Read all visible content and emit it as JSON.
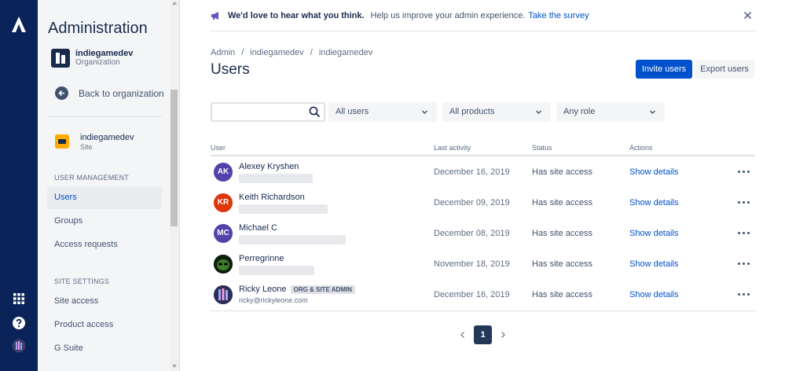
{
  "nav": {
    "title": "Administration",
    "org": {
      "name": "indiegamedev",
      "type": "Organization"
    },
    "back_label": "Back to organization",
    "site": {
      "name": "indiegamedev",
      "type": "Site"
    },
    "sections": [
      {
        "label": "USER MANAGEMENT",
        "items": [
          "Users",
          "Groups",
          "Access requests"
        ]
      },
      {
        "label": "SITE SETTINGS",
        "items": [
          "Site access",
          "Product access",
          "G Suite"
        ]
      }
    ],
    "active_item": "Users"
  },
  "banner": {
    "bold": "We'd love to hear what you think.",
    "text": "Help us improve your admin experience.",
    "link": "Take the survey"
  },
  "breadcrumb": [
    "Admin",
    "indiegamedev",
    "indiegamedev"
  ],
  "page_title": "Users",
  "actions": {
    "invite": "Invite users",
    "export": "Export users"
  },
  "filters": {
    "search_placeholder": "",
    "users": "All users",
    "products": "All products",
    "role": "Any role"
  },
  "table": {
    "headers": {
      "user": "User",
      "last_activity": "Last activity",
      "status": "Status",
      "actions": "Actions"
    },
    "rows": [
      {
        "initials": "AK",
        "avatar_color": "#5243aa",
        "name": "Alexey Kryshen",
        "email": "",
        "badge": "",
        "last_activity": "December 16, 2019",
        "status": "Has site access",
        "action": "Show details"
      },
      {
        "initials": "KR",
        "avatar_color": "#de350b",
        "name": "Keith Richardson",
        "email": "",
        "badge": "",
        "last_activity": "December 09, 2019",
        "status": "Has site access",
        "action": "Show details"
      },
      {
        "initials": "MC",
        "avatar_color": "#5243aa",
        "name": "Michael C",
        "email": "",
        "badge": "",
        "last_activity": "December 08, 2019",
        "status": "Has site access",
        "action": "Show details"
      },
      {
        "initials": "",
        "avatar_color": "#1b3a1b",
        "name": "Perregrinne",
        "email": "",
        "badge": "",
        "last_activity": "November 18, 2019",
        "status": "Has site access",
        "action": "Show details"
      },
      {
        "initials": "",
        "avatar_color": "#3b3f6b",
        "name": "Ricky Leone",
        "email": "ricky@rickyleone.com",
        "badge": "ORG & SITE ADMIN",
        "last_activity": "December 16, 2019",
        "status": "Has site access",
        "action": "Show details"
      }
    ]
  },
  "pagination": {
    "current": "1"
  },
  "colors": {
    "rail": "#0a2359",
    "primary": "#0052cc"
  }
}
